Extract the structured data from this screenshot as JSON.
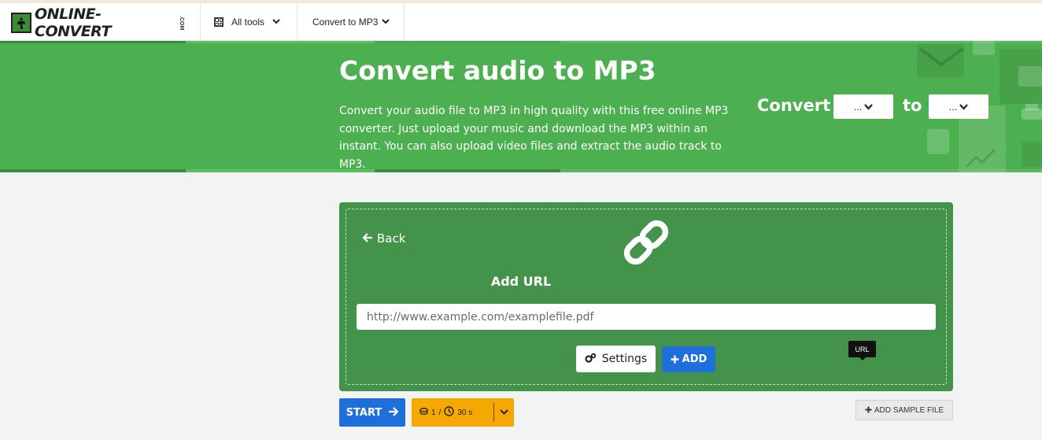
{
  "nav": {
    "logo_text": "ONLINE-CONVERT",
    "logo_suffix": ".COM",
    "all_tools_label": "All tools",
    "convert_to_label": "Convert to MP3"
  },
  "banner": {
    "title": "Convert audio to MP3",
    "description": "Convert your audio file to MP3 in high quality with this free online MP3 converter. Just upload your music and download the MP3 within an instant. You can also upload video files and extract the audio track to MP3.",
    "convert_label": "Convert",
    "to_label": "to",
    "from_select_value": "...",
    "to_select_value": "..."
  },
  "upload": {
    "back_label": "Back",
    "add_url_title": "Add URL",
    "url_placeholder": "http://www.example.com/examplefile.pdf",
    "settings_label": "Settings",
    "add_label": "ADD",
    "tooltip": "URL"
  },
  "actions": {
    "start_label": "START",
    "credits_count": "1",
    "credits_sep": "/",
    "time_label": "30 s",
    "sample_label": "ADD SAMPLE FILE"
  },
  "colors": {
    "banner_green": "#4caf50",
    "upload_green": "#43944a",
    "primary_blue": "#1e6fd9",
    "credits_orange": "#f5a900"
  }
}
